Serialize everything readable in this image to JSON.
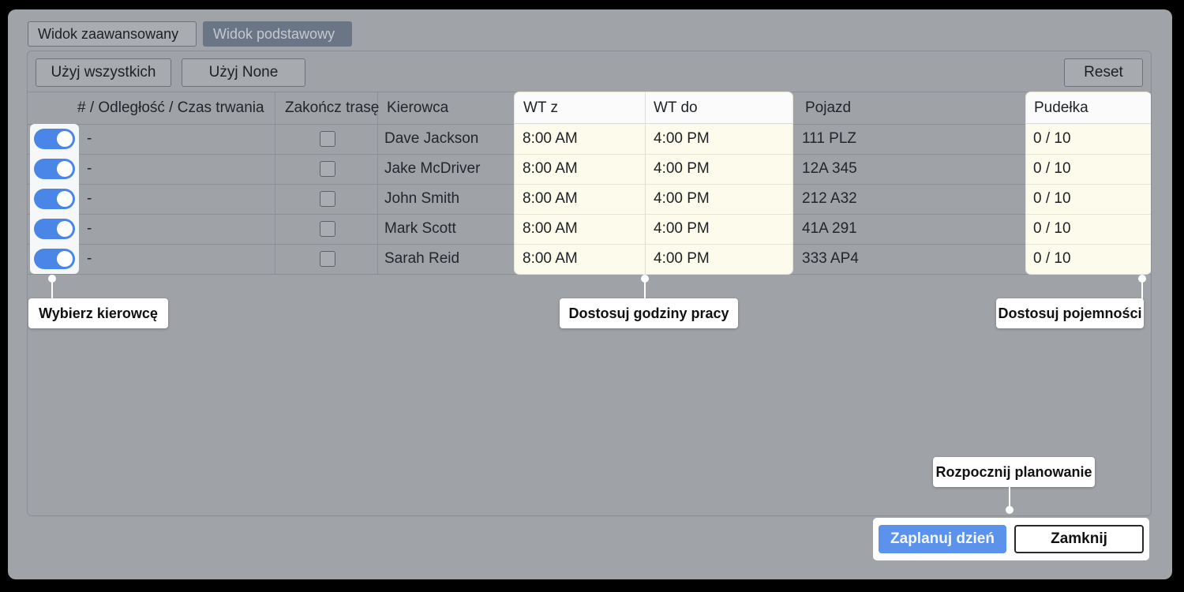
{
  "view_tabs": {
    "advanced": "Widok zaawansowany",
    "basic": "Widok podstawowy"
  },
  "toolbar": {
    "use_all": "Użyj wszystkich",
    "use_none": "Użyj None",
    "reset": "Reset"
  },
  "table": {
    "headers": {
      "num_dist_time": "# / Odległość / Czas trwania",
      "end_route": "Zakończ trasę",
      "driver": "Kierowca",
      "wt_from": "WT z",
      "wt_to": "WT do",
      "vehicle": "Pojazd",
      "boxes": "Pudełka"
    },
    "rows": [
      {
        "enabled": true,
        "stats": "-",
        "end_route": false,
        "driver": "Dave Jackson",
        "wt_from": "8:00 AM",
        "wt_to": "4:00 PM",
        "vehicle": "111 PLZ",
        "boxes": "0 / 10"
      },
      {
        "enabled": true,
        "stats": "-",
        "end_route": false,
        "driver": "Jake McDriver",
        "wt_from": "8:00 AM",
        "wt_to": "4:00 PM",
        "vehicle": "12A 345",
        "boxes": "0 / 10"
      },
      {
        "enabled": true,
        "stats": "-",
        "end_route": false,
        "driver": "John Smith",
        "wt_from": "8:00 AM",
        "wt_to": "4:00 PM",
        "vehicle": "212 A32",
        "boxes": "0 / 10"
      },
      {
        "enabled": true,
        "stats": "-",
        "end_route": false,
        "driver": "Mark Scott",
        "wt_from": "8:00 AM",
        "wt_to": "4:00 PM",
        "vehicle": "41A 291",
        "boxes": "0 / 10"
      },
      {
        "enabled": true,
        "stats": "-",
        "end_route": false,
        "driver": "Sarah Reid",
        "wt_from": "8:00 AM",
        "wt_to": "4:00 PM",
        "vehicle": "333 AP4",
        "boxes": "0 / 10"
      }
    ]
  },
  "callouts": {
    "select_driver": "Wybierz kierowcę",
    "adjust_hours": "Dostosuj godziny pracy",
    "adjust_capacity": "Dostosuj pojemności",
    "start_planning": "Rozpocznij planowanie"
  },
  "actions": {
    "plan_day": "Zaplanuj dzień",
    "close": "Zamknij"
  },
  "colors": {
    "accent": "#4a86e8",
    "highlight_column": "#fdfbec",
    "background": "#a0a3a8"
  }
}
